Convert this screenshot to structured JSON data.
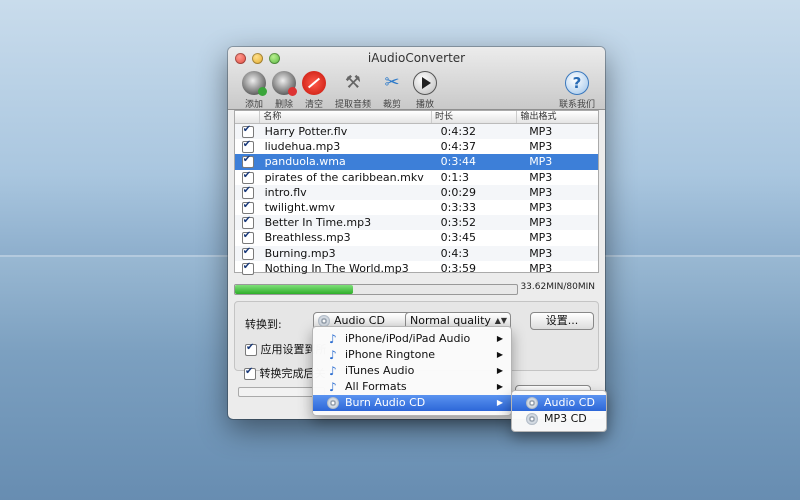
{
  "app": {
    "title": "iAudioConverter"
  },
  "toolbar": {
    "add": "添加",
    "remove": "删除",
    "clear": "清空",
    "extract": "提取音频",
    "cut": "裁剪",
    "play": "播放",
    "contact": "联系我们"
  },
  "table": {
    "headers": {
      "name": "名称",
      "duration": "时长",
      "format": "输出格式"
    },
    "rows": [
      {
        "name": "Harry Potter.flv",
        "duration": "0:4:32",
        "format": "MP3",
        "checked": true
      },
      {
        "name": "liudehua.mp3",
        "duration": "0:4:37",
        "format": "MP3",
        "checked": true
      },
      {
        "name": "panduola.wma",
        "duration": "0:3:44",
        "format": "MP3",
        "checked": true,
        "selected": true
      },
      {
        "name": "pirates of the caribbean.mkv",
        "duration": "0:1:3",
        "format": "MP3",
        "checked": true
      },
      {
        "name": "intro.flv",
        "duration": "0:0:29",
        "format": "MP3",
        "checked": true
      },
      {
        "name": "twilight.wmv",
        "duration": "0:3:33",
        "format": "MP3",
        "checked": true
      },
      {
        "name": "Better In Time.mp3",
        "duration": "0:3:52",
        "format": "MP3",
        "checked": true
      },
      {
        "name": "Breathless.mp3",
        "duration": "0:3:45",
        "format": "MP3",
        "checked": true
      },
      {
        "name": "Burning.mp3",
        "duration": "0:4:3",
        "format": "MP3",
        "checked": true
      },
      {
        "name": "Nothing In The World.mp3",
        "duration": "0:3:59",
        "format": "MP3",
        "checked": true
      }
    ]
  },
  "capacity": {
    "text": "33.62MIN/80MIN",
    "fraction": 0.42
  },
  "settings": {
    "convert_to_label": "转换到:",
    "format_selected": "Audio CD",
    "quality_selected": "Normal quality",
    "settings_button": "设置...",
    "apply_all_label": "应用设置到所",
    "after_convert_label": "转换完成后关"
  },
  "format_menu": {
    "items": [
      {
        "label": "iPhone/iPod/iPad Audio",
        "icon": "music-note-icon"
      },
      {
        "label": "iPhone Ringtone",
        "icon": "music-note-icon"
      },
      {
        "label": "iTunes Audio",
        "icon": "music-note-icon"
      },
      {
        "label": "All Formats",
        "icon": "music-note-icon"
      },
      {
        "label": "Burn Audio CD",
        "icon": "disc-icon",
        "highlighted": true
      }
    ]
  },
  "submenu": {
    "items": [
      {
        "label": "Audio CD",
        "icon": "disc-icon",
        "highlighted": true
      },
      {
        "label": "MP3 CD",
        "icon": "disc-icon"
      }
    ]
  },
  "colors": {
    "selection": "#3d7fd8",
    "progress": "#2fae2a",
    "menu_highlight": "#2d67d8"
  }
}
